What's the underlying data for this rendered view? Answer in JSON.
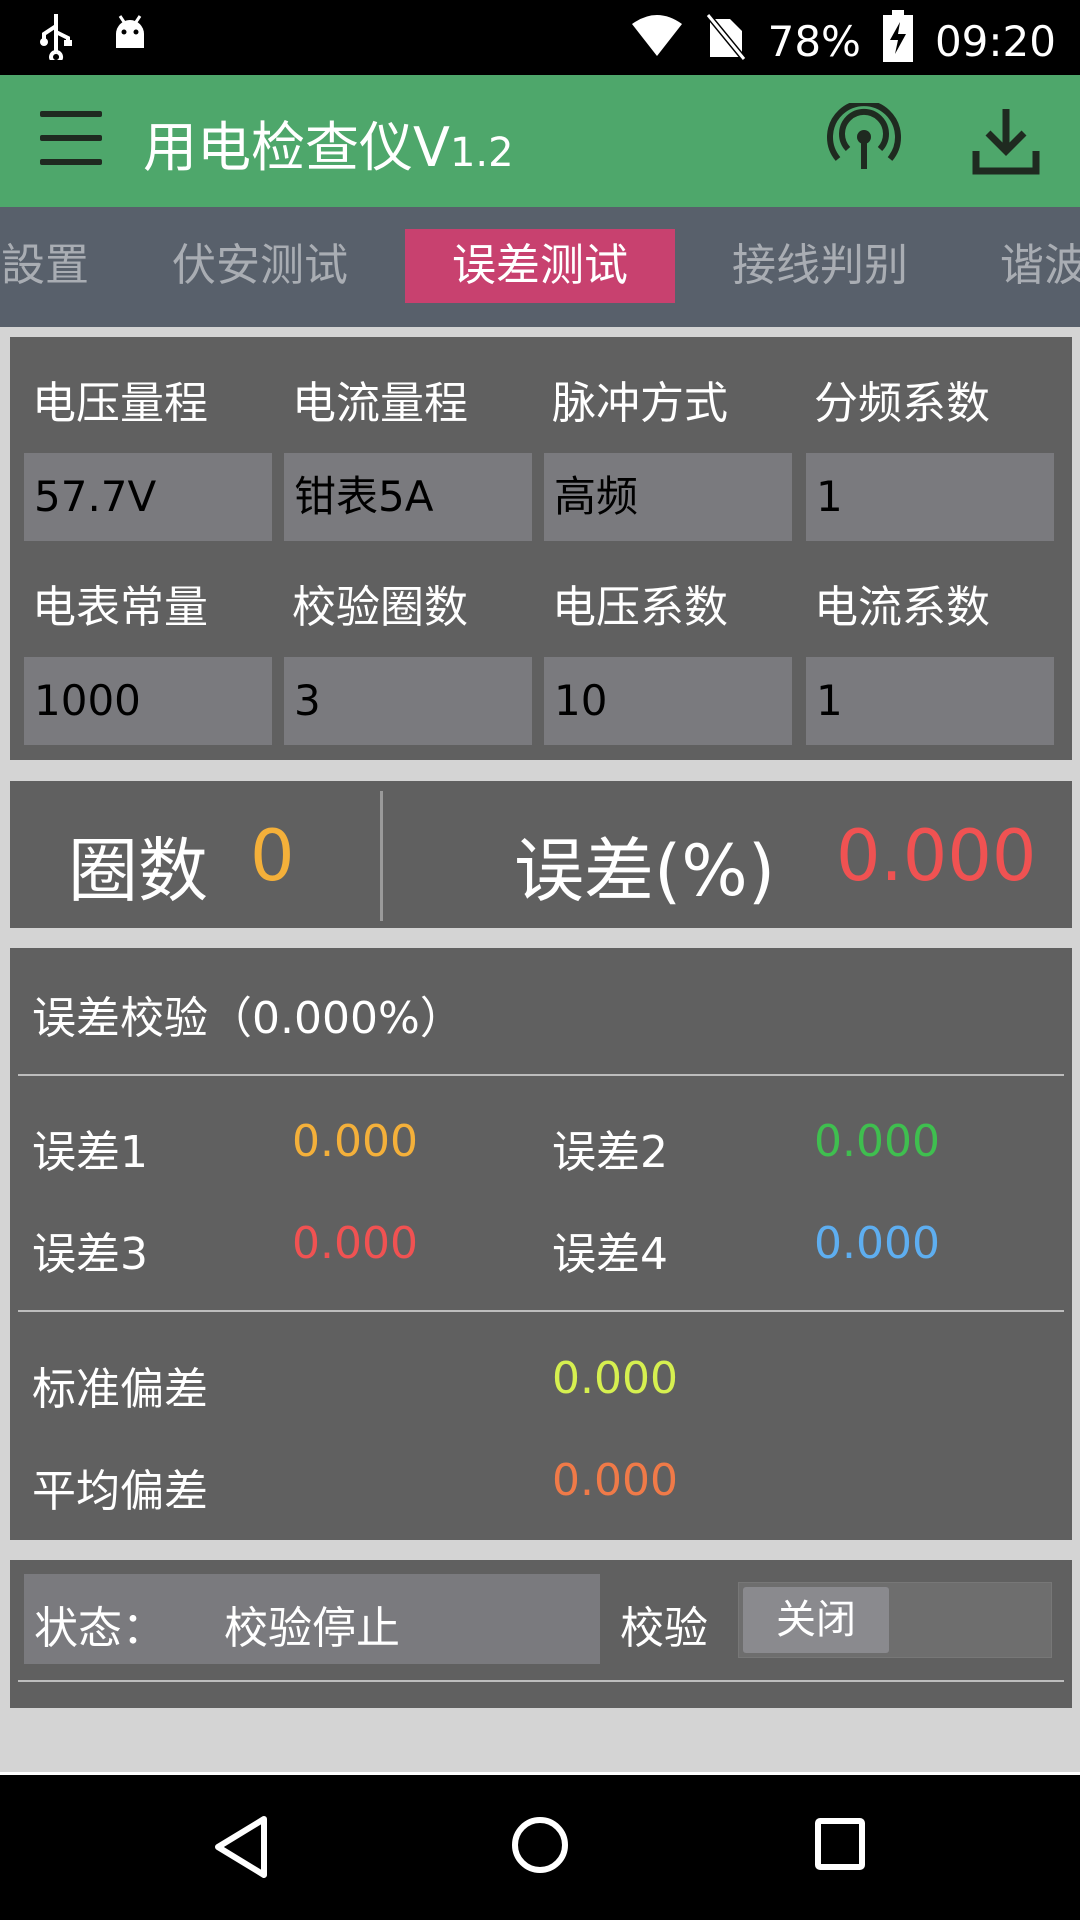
{
  "statusbar": {
    "icons_left": [
      "usb-icon",
      "android-icon"
    ],
    "icons_right": [
      "wifi-icon",
      "no-sim-icon"
    ],
    "battery": "78%",
    "time": "09:20"
  },
  "appbar": {
    "title": "用电检查仪V",
    "version": "1.2",
    "menu_icon": "menu-icon",
    "actions": [
      "wireless-icon",
      "download-icon"
    ],
    "color": "#4ea76b"
  },
  "tabs": [
    {
      "label": "設置",
      "active": false
    },
    {
      "label": "伏安测试",
      "active": false
    },
    {
      "label": "误差测试",
      "active": true
    },
    {
      "label": "接线判别",
      "active": false
    },
    {
      "label": "谐波",
      "active": false
    }
  ],
  "params": {
    "row1_labels": [
      "电压量程",
      "电流量程",
      "脉冲方式",
      "分频系数"
    ],
    "row1_values": [
      "57.7V",
      "钳表5A",
      "高频",
      "1"
    ],
    "row2_labels": [
      "电表常量",
      "校验圈数",
      "电压系数",
      "电流系数"
    ],
    "row2_values": [
      "1000",
      "3",
      "10",
      "1"
    ]
  },
  "summary": {
    "laps_label": "圈数",
    "laps_value": "0",
    "error_label": "误差(%)",
    "error_value": "0.000"
  },
  "check": {
    "title": "误差校验（0.000%）",
    "err1_label": "误差1",
    "err1_value": "0.000",
    "err2_label": "误差2",
    "err2_value": "0.000",
    "err3_label": "误差3",
    "err3_value": "0.000",
    "err4_label": "误差4",
    "err4_value": "0.000",
    "std_label": "标准偏差",
    "std_value": "0.000",
    "avg_label": "平均偏差",
    "avg_value": "0.000"
  },
  "status": {
    "label": "状态：",
    "value": "校验停止",
    "check_label": "校验",
    "toggle_label": "关闭"
  },
  "navbar": [
    "back-icon",
    "home-icon",
    "recents-icon"
  ]
}
